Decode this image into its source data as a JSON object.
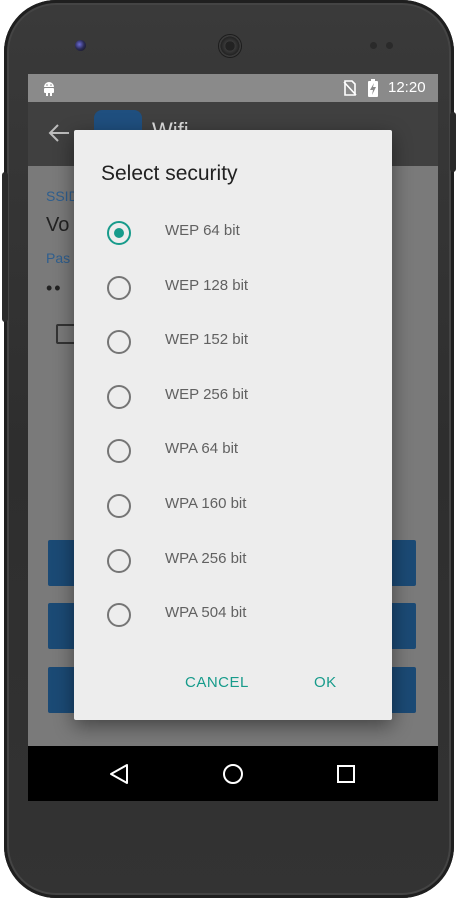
{
  "status_bar": {
    "time": "12:20"
  },
  "app_bar": {
    "title": "Wifi"
  },
  "background_form": {
    "ssid_label": "SSID",
    "ssid_value": "Vo",
    "password_label": "Pas",
    "password_dots": "••"
  },
  "dialog": {
    "title": "Select security",
    "options": [
      {
        "label": "WEP 64 bit",
        "checked": true
      },
      {
        "label": "WEP 128 bit",
        "checked": false
      },
      {
        "label": "WEP 152 bit",
        "checked": false
      },
      {
        "label": "WEP 256 bit",
        "checked": false
      },
      {
        "label": "WPA 64 bit",
        "checked": false
      },
      {
        "label": "WPA 160 bit",
        "checked": false
      },
      {
        "label": "WPA 256 bit",
        "checked": false
      },
      {
        "label": "WPA 504 bit",
        "checked": false
      }
    ],
    "cancel_label": "CANCEL",
    "ok_label": "OK"
  },
  "colors": {
    "accent": "#179b8b",
    "primary_button": "#1b4a75",
    "dialog_bg": "#ededed"
  },
  "icons": [
    "android-icon",
    "no-sim-icon",
    "battery-charging-icon",
    "back-arrow-icon",
    "nav-back-icon",
    "nav-home-icon",
    "nav-recents-icon"
  ]
}
